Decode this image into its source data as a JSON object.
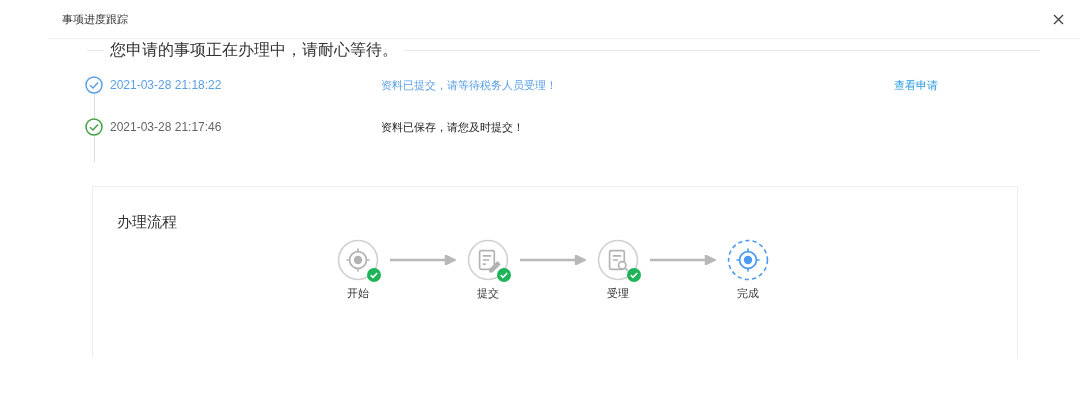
{
  "dialog": {
    "title": "事项进度跟踪"
  },
  "heading": "您申请的事项正在办理中，请耐心等待。",
  "timeline": [
    {
      "time": "2021-03-28 21:18:22",
      "message": "资料已提交，请等待税务人员受理！",
      "link": "查看申请",
      "current": true
    },
    {
      "time": "2021-03-28 21:17:46",
      "message": "资料已保存，请您及时提交！",
      "current": false
    }
  ],
  "process": {
    "title": "办理流程",
    "steps": [
      {
        "label": "开始",
        "kind": "start",
        "done": true,
        "current": false
      },
      {
        "label": "提交",
        "kind": "submit",
        "done": true,
        "current": false
      },
      {
        "label": "受理",
        "kind": "review",
        "done": true,
        "current": false
      },
      {
        "label": "完成",
        "kind": "finish",
        "done": false,
        "current": true
      }
    ]
  }
}
